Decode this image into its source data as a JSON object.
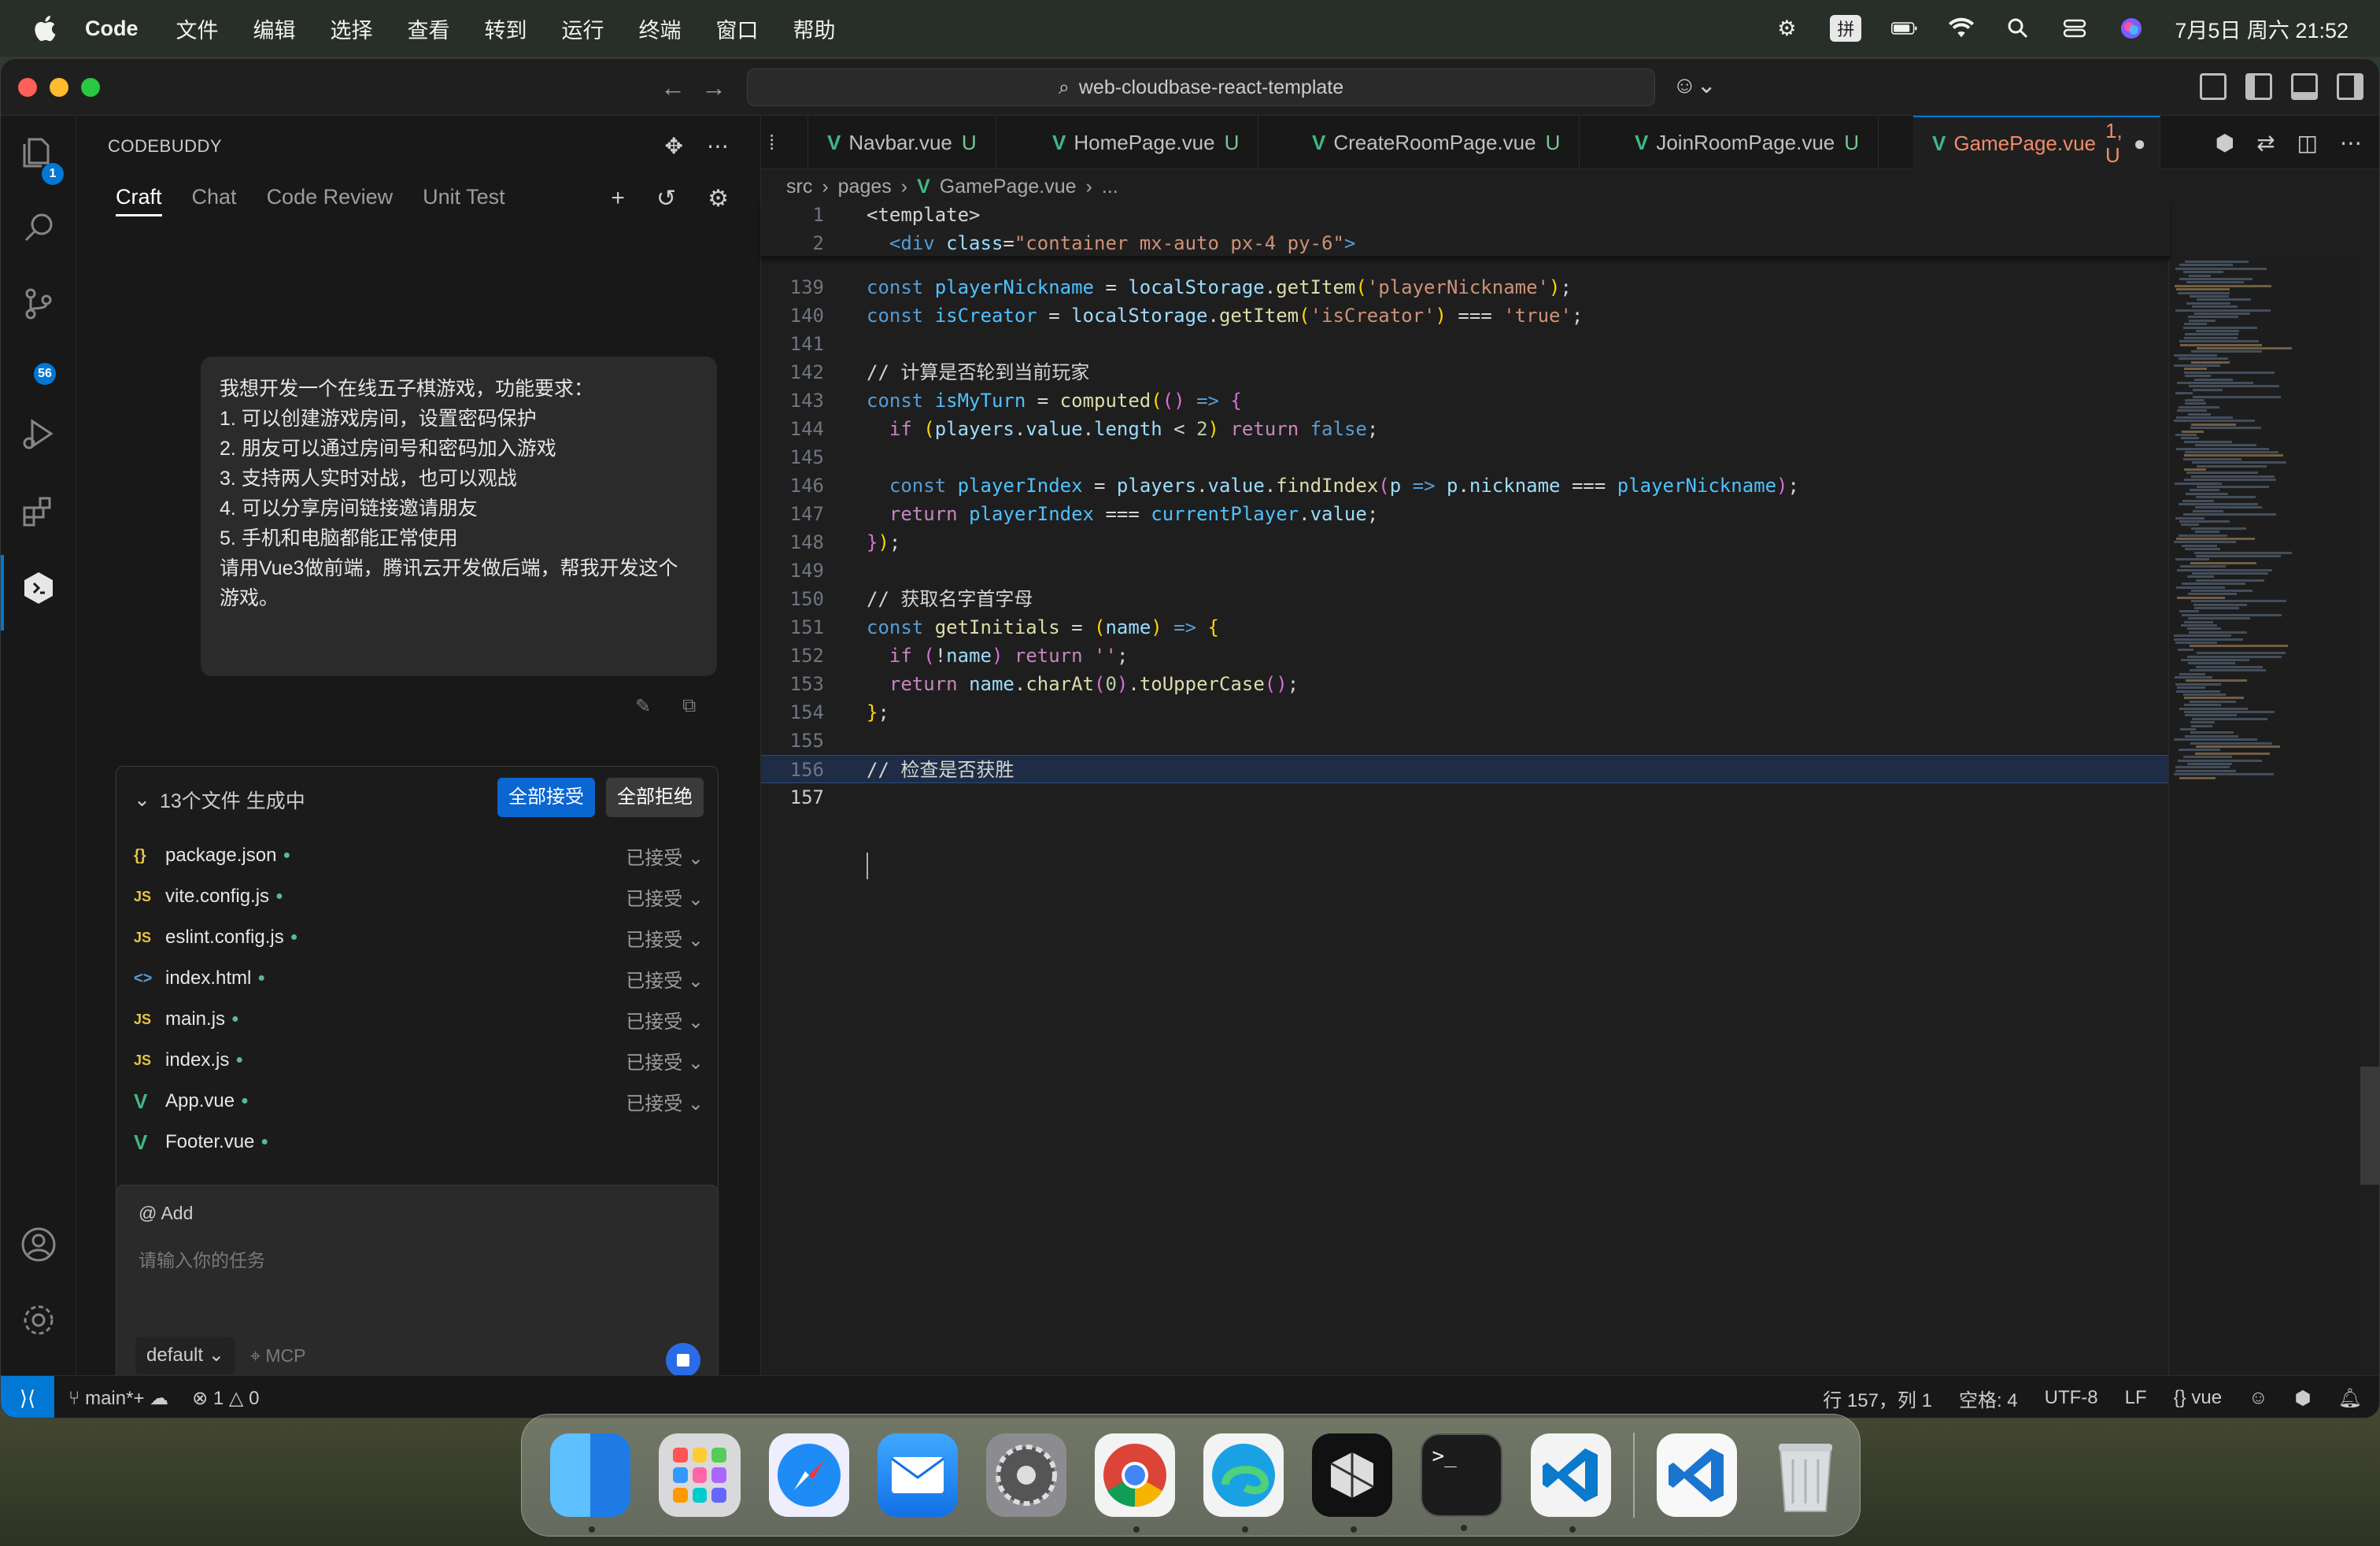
{
  "menubar": {
    "app_name": "Code",
    "items": [
      "文件",
      "编辑",
      "选择",
      "查看",
      "转到",
      "运行",
      "终端",
      "窗口",
      "帮助"
    ],
    "clock": "7月5日 周六  21:52",
    "input_method": "拼"
  },
  "titlebar": {
    "search_text": "web-cloudbase-react-template"
  },
  "activity": {
    "explorer_badge": "1",
    "scm_badge": "56"
  },
  "sidepanel": {
    "title": "CODEBUDDY",
    "tabs": [
      "Craft",
      "Chat",
      "Code Review",
      "Unit Test"
    ],
    "message": {
      "lines": [
        "我想开发一个在线五子棋游戏，功能要求：",
        "",
        "1. 可以创建游戏房间，设置密码保护",
        "2. 朋友可以通过房间号和密码加入游戏",
        "3. 支持两人实时对战，也可以观战",
        "4. 可以分享房间链接邀请朋友",
        "5. 手机和电脑都能正常使用",
        "",
        "请用Vue3做前端，腾讯云开发做后端，帮我开发这个",
        "游戏。"
      ]
    },
    "files": {
      "header": "13个文件 生成中",
      "accept_all": "全部接受",
      "reject_all": "全部拒绝",
      "items": [
        {
          "name": "package.json",
          "icon": "{}",
          "type": "json",
          "status": "已接受"
        },
        {
          "name": "vite.config.js",
          "icon": "JS",
          "type": "js",
          "status": "已接受"
        },
        {
          "name": "eslint.config.js",
          "icon": "JS",
          "type": "js",
          "status": "已接受"
        },
        {
          "name": "index.html",
          "icon": "<>",
          "type": "html",
          "status": "已接受"
        },
        {
          "name": "main.js",
          "icon": "JS",
          "type": "js",
          "status": "已接受"
        },
        {
          "name": "index.js",
          "icon": "JS",
          "type": "js",
          "status": "已接受"
        },
        {
          "name": "App.vue",
          "icon": "V",
          "type": "vue",
          "status": "已接受"
        },
        {
          "name": "Footer.vue",
          "icon": "V",
          "type": "vue",
          "status": ""
        }
      ]
    },
    "input": {
      "add_label": "@ Add",
      "placeholder": "请输入你的任务",
      "model": "default",
      "mcp": "MCP"
    }
  },
  "editor": {
    "tabs": [
      {
        "name": "Navbar.vue",
        "status": "U"
      },
      {
        "name": "HomePage.vue",
        "status": "U"
      },
      {
        "name": "CreateRoomPage.vue",
        "status": "U"
      },
      {
        "name": "JoinRoomPage.vue",
        "status": "U"
      },
      {
        "name": "GamePage.vue",
        "status": "1, U"
      }
    ],
    "breadcrumb": [
      "src",
      "pages",
      "GamePage.vue",
      "..."
    ],
    "sticky_lines": [
      {
        "ln": "1",
        "text": "<template>"
      },
      {
        "ln": "2",
        "text": "  <div class=\"container mx-auto px-4 py-6\">"
      }
    ],
    "lines": [
      {
        "ln": "139",
        "text": "const playerNickname = localStorage.getItem('playerNickname');"
      },
      {
        "ln": "140",
        "text": "const isCreator = localStorage.getItem('isCreator') === 'true';"
      },
      {
        "ln": "141",
        "text": ""
      },
      {
        "ln": "142",
        "text": "// 计算是否轮到当前玩家"
      },
      {
        "ln": "143",
        "text": "const isMyTurn = computed(() => {"
      },
      {
        "ln": "144",
        "text": "  if (players.value.length < 2) return false;"
      },
      {
        "ln": "145",
        "text": ""
      },
      {
        "ln": "146",
        "text": "  const playerIndex = players.value.findIndex(p => p.nickname === playerNickname);"
      },
      {
        "ln": "147",
        "text": "  return playerIndex === currentPlayer.value;"
      },
      {
        "ln": "148",
        "text": "});"
      },
      {
        "ln": "149",
        "text": ""
      },
      {
        "ln": "150",
        "text": "// 获取名字首字母"
      },
      {
        "ln": "151",
        "text": "const getInitials = (name) => {"
      },
      {
        "ln": "152",
        "text": "  if (!name) return '';"
      },
      {
        "ln": "153",
        "text": "  return name.charAt(0).toUpperCase();"
      },
      {
        "ln": "154",
        "text": "};"
      },
      {
        "ln": "155",
        "text": ""
      },
      {
        "ln": "156",
        "text": "// 检查是否获胜"
      },
      {
        "ln": "157",
        "text": ""
      }
    ]
  },
  "statusbar": {
    "branch": "main*+",
    "errors": "1",
    "warnings": "0",
    "position": "行 157，列 1",
    "spaces": "空格: 4",
    "encoding": "UTF-8",
    "eol": "LF",
    "language": "vue"
  },
  "dock": {
    "apps": [
      "finder-icon",
      "launchpad-icon",
      "safari-icon",
      "mail-icon",
      "system-settings-icon",
      "chrome-icon",
      "edge-icon",
      "cursor-icon",
      "terminal-icon",
      "vscode-icon",
      "vscode-insiders-icon",
      "trash-icon"
    ]
  }
}
